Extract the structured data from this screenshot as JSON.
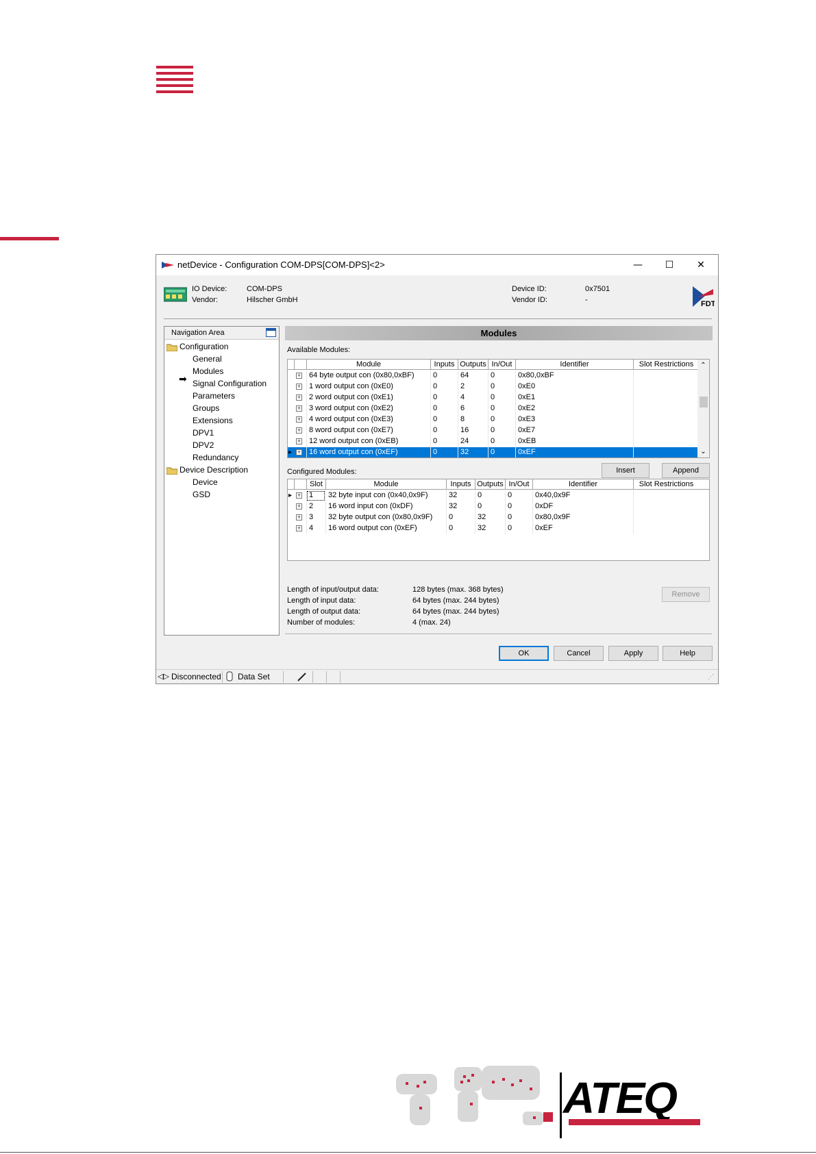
{
  "window": {
    "title": "netDevice - Configuration COM-DPS[COM-DPS]<2>",
    "min_glyph": "—",
    "max_glyph": "☐",
    "close_glyph": "✕"
  },
  "device": {
    "io_device_label": "IO Device:",
    "io_device_value": "COM-DPS",
    "vendor_label": "Vendor:",
    "vendor_value": "Hilscher GmbH",
    "device_id_label": "Device ID:",
    "device_id_value": "0x7501",
    "vendor_id_label": "Vendor ID:",
    "vendor_id_value": "-",
    "fdt_logo_text": "FDT"
  },
  "nav": {
    "header": "Navigation Area",
    "items": [
      {
        "label": "Configuration",
        "level": 0
      },
      {
        "label": "General",
        "level": 1
      },
      {
        "label": "Modules",
        "level": 1,
        "selected": true
      },
      {
        "label": "Signal Configuration",
        "level": 1
      },
      {
        "label": "Parameters",
        "level": 1
      },
      {
        "label": "Groups",
        "level": 1
      },
      {
        "label": "Extensions",
        "level": 1
      },
      {
        "label": "DPV1",
        "level": 1
      },
      {
        "label": "DPV2",
        "level": 1
      },
      {
        "label": "Redundancy",
        "level": 1
      },
      {
        "label": "Device Description",
        "level": 0
      },
      {
        "label": "Device",
        "level": 1
      },
      {
        "label": "GSD",
        "level": 1
      }
    ]
  },
  "main": {
    "title": "Modules",
    "available_label": "Available Modules:",
    "available_headers": [
      "Module",
      "Inputs",
      "Outputs",
      "In/Out",
      "Identifier",
      "Slot Restrictions"
    ],
    "available_rows": [
      [
        "64 byte output con (0x80,0xBF)",
        "0",
        "64",
        "0",
        "0x80,0xBF",
        ""
      ],
      [
        "1  word output con (0xE0)",
        "0",
        "2",
        "0",
        "0xE0",
        ""
      ],
      [
        "2  word output con (0xE1)",
        "0",
        "4",
        "0",
        "0xE1",
        ""
      ],
      [
        "3  word output con (0xE2)",
        "0",
        "6",
        "0",
        "0xE2",
        ""
      ],
      [
        "4  word output con (0xE3)",
        "0",
        "8",
        "0",
        "0xE3",
        ""
      ],
      [
        "8  word output con (0xE7)",
        "0",
        "16",
        "0",
        "0xE7",
        ""
      ],
      [
        "12 word output con (0xEB)",
        "0",
        "24",
        "0",
        "0xEB",
        ""
      ],
      [
        "16 word output con (0xEF)",
        "0",
        "32",
        "0",
        "0xEF",
        ""
      ]
    ],
    "available_selected_index": 7,
    "insert_button": "Insert",
    "append_button": "Append",
    "configured_label": "Configured Modules:",
    "configured_headers": [
      "Slot",
      "Module",
      "Inputs",
      "Outputs",
      "In/Out",
      "Identifier",
      "Slot Restrictions"
    ],
    "configured_rows": [
      [
        "1",
        "32 byte input con  (0x40,0x9F)",
        "32",
        "0",
        "0",
        "0x40,0x9F",
        ""
      ],
      [
        "2",
        "16 word input con  (0xDF)",
        "32",
        "0",
        "0",
        "0xDF",
        ""
      ],
      [
        "3",
        "32 byte output con (0x80,0x9F)",
        "0",
        "32",
        "0",
        "0x80,0x9F",
        ""
      ],
      [
        "4",
        "16 word output con (0xEF)",
        "0",
        "32",
        "0",
        "0xEF",
        ""
      ]
    ],
    "remove_button": "Remove",
    "stats": [
      {
        "label": "Length of input/output data:",
        "value": "128 bytes (max. 368 bytes)"
      },
      {
        "label": "Length of input data:",
        "value": "64 bytes (max. 244 bytes)"
      },
      {
        "label": "Length of output data:",
        "value": "64 bytes (max. 244 bytes)"
      },
      {
        "label": "Number of modules:",
        "value": "4 (max. 24)"
      }
    ]
  },
  "dialog_buttons": {
    "ok": "OK",
    "cancel": "Cancel",
    "apply": "Apply",
    "help": "Help"
  },
  "statusbar": {
    "connection": "Disconnected",
    "dataset": "Data Set"
  },
  "brand": {
    "logo_text": "ATEQ",
    "accent_color": "#c8233f",
    "selection_color": "#0078d7"
  }
}
